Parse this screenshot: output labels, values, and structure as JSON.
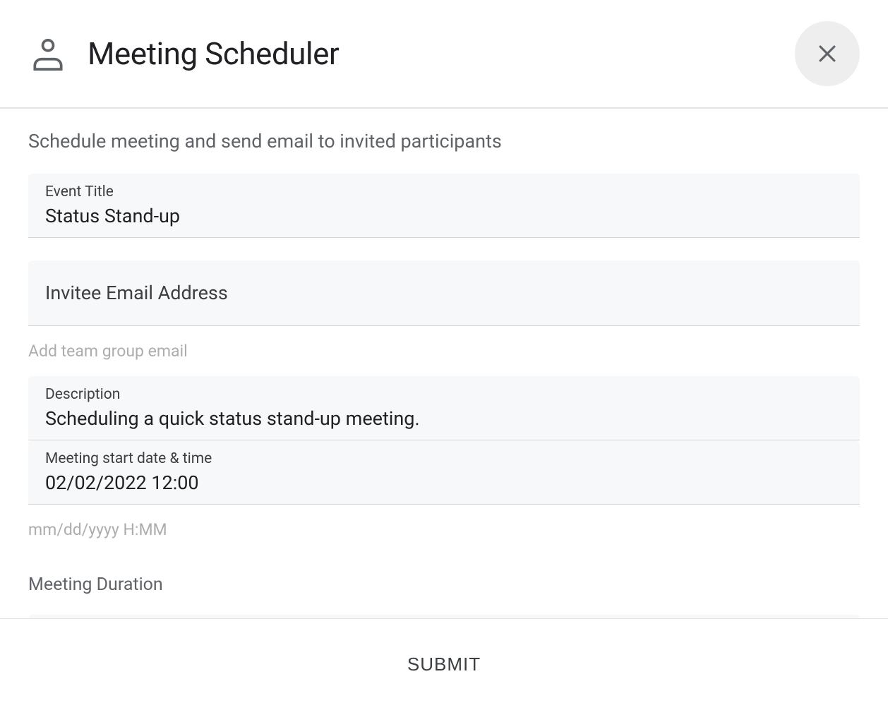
{
  "header": {
    "title": "Meeting Scheduler"
  },
  "subtitle": "Schedule meeting and send email to invited participants",
  "form": {
    "event_title": {
      "label": "Event Title",
      "value": "Status Stand-up"
    },
    "invitee_email": {
      "label": "Invitee Email Address",
      "helper": "Add team group email"
    },
    "description": {
      "label": "Description",
      "value": "Scheduling a quick status stand-up meeting."
    },
    "start_datetime": {
      "label": "Meeting start date & time",
      "value": "02/02/2022 12:00",
      "helper": "mm/dd/yyyy H:MM"
    },
    "duration": {
      "label": "Meeting Duration"
    }
  },
  "footer": {
    "submit_label": "SUBMIT"
  }
}
